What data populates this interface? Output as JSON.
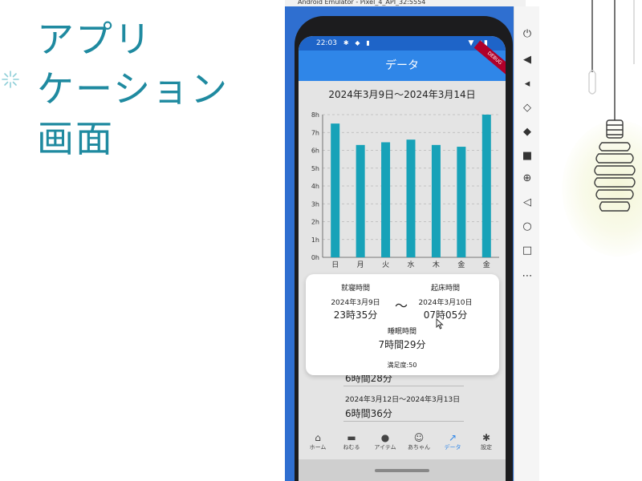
{
  "slide": {
    "title_lines": [
      "アプリ",
      "ケーション",
      "画面"
    ]
  },
  "emulator": {
    "window_title": "Android Emulator - Pixel_4_API_32:5554"
  },
  "status_bar": {
    "time": "22:03"
  },
  "app_bar": {
    "title": "データ",
    "debug_banner": "DEBUG"
  },
  "range_title": "2024年3月9日〜2024年3月14日",
  "chart_data": {
    "type": "bar",
    "categories": [
      "日",
      "月",
      "火",
      "水",
      "木",
      "金",
      "金"
    ],
    "values": [
      7.5,
      6.3,
      6.45,
      6.6,
      6.3,
      6.2,
      8.0
    ],
    "y_tick_labels": [
      "0h",
      "1h",
      "2h",
      "3h",
      "4h",
      "5h",
      "6h",
      "7h",
      "8h"
    ],
    "ylim": [
      0,
      8
    ],
    "grid": true,
    "bar_color": "#17a2b8"
  },
  "detail_card": {
    "bedtime_label": "就寝時間",
    "bedtime_date": "2024年3月9日",
    "bedtime_time": "23時35分",
    "separator": "〜",
    "wake_label": "起床時間",
    "wake_date": "2024年3月10日",
    "wake_time": "07時05分",
    "sleep_label": "睡眠時間",
    "sleep_value": "7時間29分",
    "satisfaction": "満足度:50"
  },
  "list": {
    "item1_value": "6時間28分",
    "item2_range": "2024年3月12日〜2024年3月13日",
    "item2_value": "6時間36分"
  },
  "bottom_nav": [
    {
      "label": "ホーム",
      "icon": "home-icon",
      "glyph": "⌂"
    },
    {
      "label": "ねむる",
      "icon": "bed-icon",
      "glyph": "▬"
    },
    {
      "label": "アイテム",
      "icon": "drop-icon",
      "glyph": "●"
    },
    {
      "label": "あちゃん",
      "icon": "face-icon",
      "glyph": "☺"
    },
    {
      "label": "データ",
      "icon": "trend-icon",
      "glyph": "↗"
    },
    {
      "label": "設定",
      "icon": "gear-icon",
      "glyph": "✱"
    }
  ],
  "colors": {
    "title_teal": "#1f8aa0",
    "app_bar": "#2f86e8",
    "status_bar": "#1e64c8",
    "bar": "#17a2b8"
  }
}
